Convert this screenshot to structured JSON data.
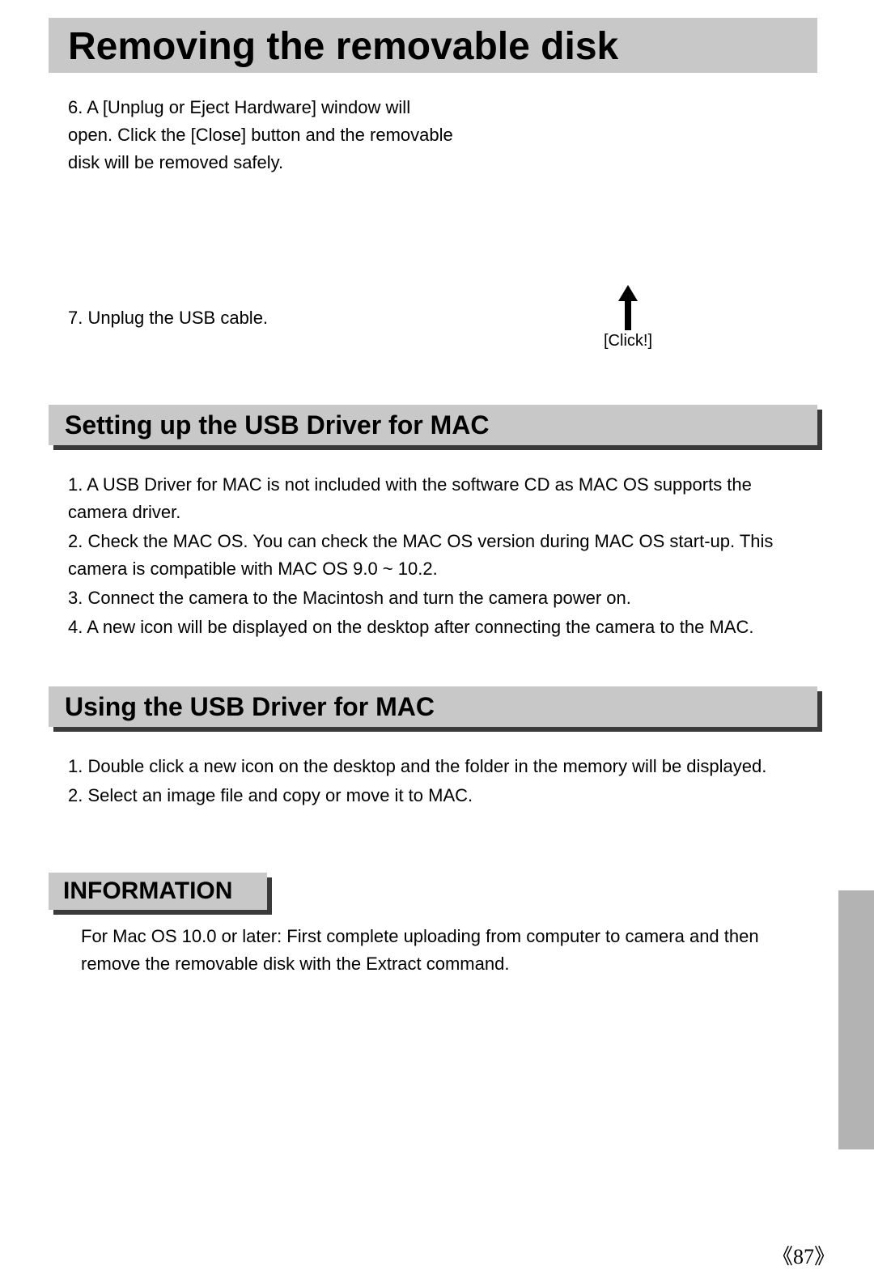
{
  "title": "Removing the removable disk",
  "step6": "6. A [Unplug or Eject Hardware] window will open. Click the [Close] button and the removable disk will be removed safely.",
  "step7": "7. Unplug the USB cable.",
  "click_label": "[Click!]",
  "section_setup": {
    "heading": "Setting up the USB Driver for MAC",
    "items": [
      "1. A USB Driver for MAC is not included with the software CD as MAC OS supports the camera driver.",
      "2. Check the MAC OS. You can check the MAC OS version during MAC OS start-up. This camera is compatible with MAC OS 9.0 ~ 10.2.",
      "3. Connect the camera to the Macintosh and turn the camera power on.",
      "4. A new icon will be displayed on the desktop after connecting the camera to the MAC."
    ]
  },
  "section_using": {
    "heading": "Using the USB Driver for MAC",
    "items": [
      "1. Double click a new icon on the desktop and the folder in the memory will be displayed.",
      "2. Select an image file and copy or move it to MAC."
    ]
  },
  "info": {
    "heading": "INFORMATION",
    "body": "For Mac OS 10.0 or later: First complete uploading from computer to camera and then remove the removable disk with the Extract command."
  },
  "page_number": "《87》"
}
